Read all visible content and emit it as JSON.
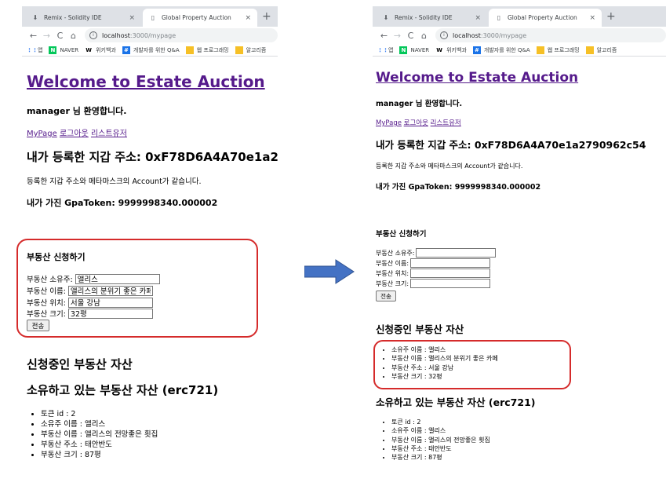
{
  "browser": {
    "tabs": [
      {
        "label": "Remix - Solidity IDE",
        "icon": "remix-icon",
        "active": false
      },
      {
        "label": "Global Property Auction",
        "icon": "page-icon",
        "active": true
      }
    ],
    "close_glyph": "×",
    "newtab_glyph": "+",
    "url_host": "localhost",
    "url_path": ":3000/mypage",
    "bookmarks": [
      {
        "label": "앱",
        "icon": "apps-grid-icon",
        "color": "#4285f4"
      },
      {
        "label": "NAVER",
        "icon": "naver-icon",
        "color": "#03c75a"
      },
      {
        "label": "위키백과",
        "icon": "wikipedia-icon",
        "color": "#ffffff"
      },
      {
        "label": "개발자를 위한 Q&A",
        "icon": "qa-icon",
        "color": "#1a73e8"
      },
      {
        "label": "웹 프로그래밍",
        "icon": "folder-icon",
        "color": "#f6c026"
      },
      {
        "label": "알고리즘",
        "icon": "folder-icon",
        "color": "#f6c026"
      }
    ]
  },
  "page": {
    "title": "Welcome to Estate Auction",
    "greeting_user": "manager",
    "greeting_suffix": " 님 환영합니다.",
    "nav_links": [
      "MyPage",
      "로그아웃",
      "리스트유저"
    ],
    "wallet_heading": "내가 등록한 지갑 주소: 0xF78D6A4A70e1a2790962c54",
    "wallet_note": "등록한 지갑 주소와 메타마스크의 Account가 같습니다.",
    "token_balance": "내가 가진 GpaToken: 9999998340.000002",
    "apply_heading": "부동산 신청하기",
    "form_labels": {
      "owner": "부동산 소유주:",
      "name": "부동산 이름:",
      "location": "부동산 위치:",
      "size": "부동산 크기:"
    },
    "submit_label": "전송",
    "pending_heading": "신청중인 부동산 자산",
    "owned_heading": "소유하고 있는 부동산 자산 (erc721)"
  },
  "left": {
    "form_values": {
      "owner": "앨리스",
      "name": "앨리스의 분위기 좋은 카페",
      "location": "서울 강남",
      "size": "32평"
    },
    "owned_items": [
      "토큰 id : 2",
      "소유주 이름 : 앨리스",
      "부동산 이름 : 앨리스의 전망좋은 횟집",
      "부동산 주소 : 태안반도",
      "부동산 크기 : 87평"
    ]
  },
  "right": {
    "form_values": {
      "owner": "",
      "name": "",
      "location": "",
      "size": ""
    },
    "pending_items": [
      "소유주 이름 : 앨리스",
      "부동산 이름 : 앨리스의 분위기 좋은 카페",
      "부동산 주소 : 서울 강남",
      "부동산 크기 : 32평"
    ],
    "owned_items": [
      "토큰 id : 2",
      "소유주 이름 : 앨리스",
      "부동산 이름 : 앨리스의 전망좋은 횟집",
      "부동산 주소 : 태안반도",
      "부동산 크기 : 87평"
    ]
  },
  "colors": {
    "highlight": "#d52b2b",
    "arrow": "#4472c4",
    "link": "#551a8b"
  }
}
